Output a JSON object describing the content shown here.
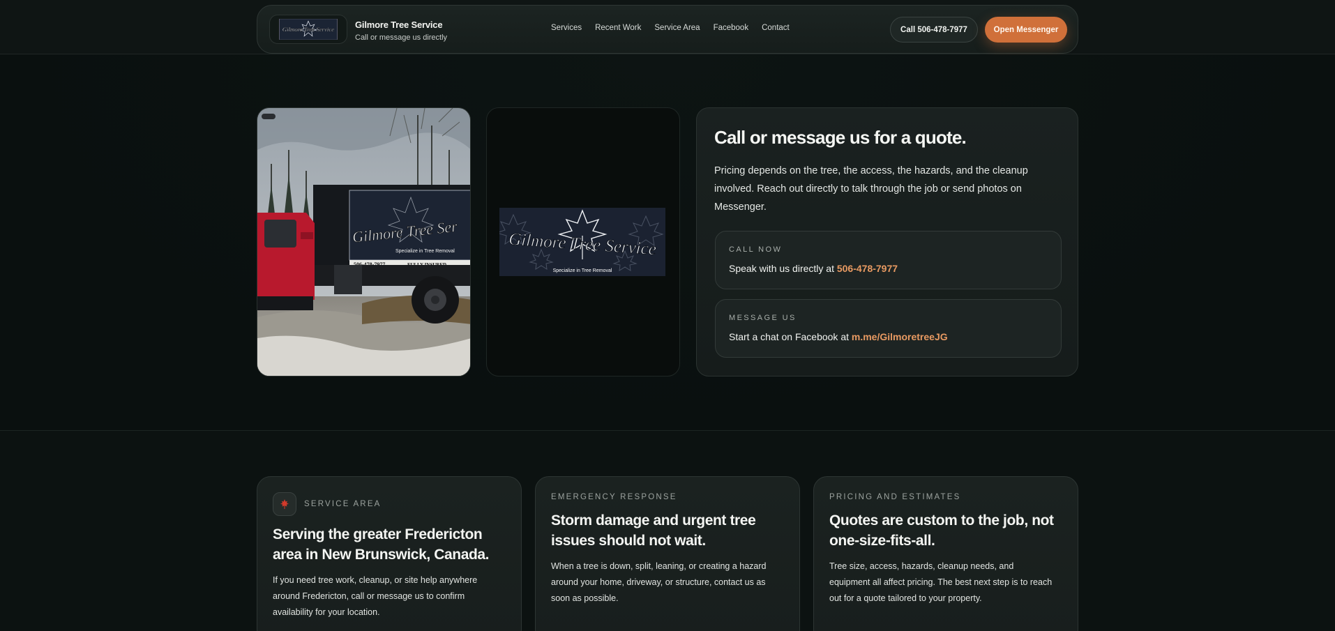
{
  "header": {
    "brand_title": "Gilmore Tree Service",
    "brand_subtitle": "Call or message us directly",
    "nav": [
      "Services",
      "Recent Work",
      "Service Area",
      "Facebook",
      "Contact"
    ],
    "call_button": "Call 506-478-7977",
    "messenger_button": "Open Messenger"
  },
  "logo_sign": {
    "name": "Gilmore Tree Service",
    "tagline": "Specialize in Tree Removal"
  },
  "truck_sign": {
    "name": "Gilmore Tree Ser",
    "tagline": "Specialize in Tree Removal",
    "phone": "506-478-7977",
    "insured": "FULLY INSURED"
  },
  "quote": {
    "title": "Call or message us for a quote.",
    "body": "Pricing depends on the tree, the access, the hazards, and the cleanup involved. Reach out directly to talk through the job or send photos on Messenger.",
    "call": {
      "eyebrow": "CALL NOW",
      "text": "Speak with us directly at ",
      "link": "506-478-7977"
    },
    "message": {
      "eyebrow": "MESSAGE US",
      "text": "Start a chat on Facebook at ",
      "link": "m.me/GilmoretreeJG"
    }
  },
  "features": [
    {
      "eyebrow": "SERVICE AREA",
      "icon": "maple-leaf-icon",
      "title": "Serving the greater Fredericton area in New Brunswick, Canada.",
      "body": "If you need tree work, cleanup, or site help anywhere around Fredericton, call or message us to confirm availability for your location."
    },
    {
      "eyebrow": "EMERGENCY RESPONSE",
      "title": "Storm damage and urgent tree issues should not wait.",
      "body": "When a tree is down, split, leaning, or creating a hazard around your home, driveway, or structure, contact us as soon as possible."
    },
    {
      "eyebrow": "PRICING AND ESTIMATES",
      "title": "Quotes are custom to the job, not one-size-fits-all.",
      "body": "Tree size, access, hazards, cleanup needs, and equipment all affect pricing. The best next step is to reach out for a quote tailored to your property."
    }
  ],
  "colors": {
    "accent": "#d0703a",
    "link": "#e89a62",
    "background": "#0c1211",
    "card": "#1a2120"
  }
}
